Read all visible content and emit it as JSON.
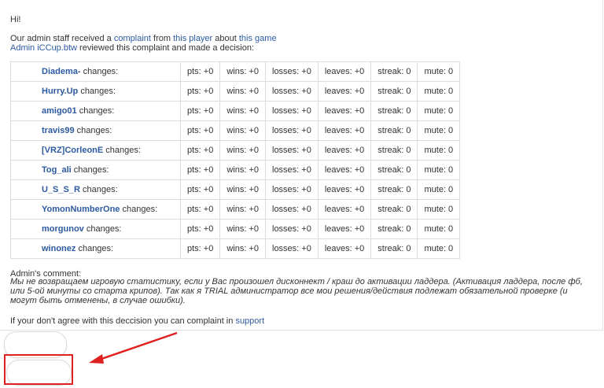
{
  "greeting": "Hi!",
  "intro": {
    "line1_pre": "Our admin staff received a",
    "complaint_link": "complaint",
    "line1_mid": "from",
    "player_link": "this player",
    "line1_mid2": "about",
    "game_link": "this game",
    "admin_link": "Admin iCCup.btw",
    "line2_post": "reviewed this complaint and made a decision:"
  },
  "changes_suffix": "changes:",
  "rows": [
    {
      "player": "Diadema-",
      "pts": "pts: +0",
      "wins": "wins: +0",
      "losses": "losses: +0",
      "leaves": "leaves: +0",
      "streak": "streak: 0",
      "mute": "mute: 0"
    },
    {
      "player": "Hurry.Up",
      "pts": "pts: +0",
      "wins": "wins: +0",
      "losses": "losses: +0",
      "leaves": "leaves: +0",
      "streak": "streak: 0",
      "mute": "mute: 0"
    },
    {
      "player": "amigo01",
      "pts": "pts: +0",
      "wins": "wins: +0",
      "losses": "losses: +0",
      "leaves": "leaves: +0",
      "streak": "streak: 0",
      "mute": "mute: 0"
    },
    {
      "player": "travis99",
      "pts": "pts: +0",
      "wins": "wins: +0",
      "losses": "losses: +0",
      "leaves": "leaves: +0",
      "streak": "streak: 0",
      "mute": "mute: 0"
    },
    {
      "player": "[VRZ]CorleonE",
      "pts": "pts: +0",
      "wins": "wins: +0",
      "losses": "losses: +0",
      "leaves": "leaves: +0",
      "streak": "streak: 0",
      "mute": "mute: 0"
    },
    {
      "player": "Tog_ali",
      "pts": "pts: +0",
      "wins": "wins: +0",
      "losses": "losses: +0",
      "leaves": "leaves: +0",
      "streak": "streak: 0",
      "mute": "mute: 0"
    },
    {
      "player": "U_S_S_R",
      "pts": "pts: +0",
      "wins": "wins: +0",
      "losses": "losses: +0",
      "leaves": "leaves: +0",
      "streak": "streak: 0",
      "mute": "mute: 0"
    },
    {
      "player": "YomonNumberOne",
      "pts": "pts: +0",
      "wins": "wins: +0",
      "losses": "losses: +0",
      "leaves": "leaves: +0",
      "streak": "streak: 0",
      "mute": "mute: 0"
    },
    {
      "player": "morgunov",
      "pts": "pts: +0",
      "wins": "wins: +0",
      "losses": "losses: +0",
      "leaves": "leaves: +0",
      "streak": "streak: 0",
      "mute": "mute: 0"
    },
    {
      "player": "winonez",
      "pts": "pts: +0",
      "wins": "wins: +0",
      "losses": "losses: +0",
      "leaves": "leaves: +0",
      "streak": "streak: 0",
      "mute": "mute: 0"
    }
  ],
  "admin_comment_label": "Admin's comment:",
  "admin_comment": "Мы не возвращаем игровую статистику, если у Вас произошел дисконнект / краш до активации ладдера. (Активация ладдера, после фб, или 5-ой минуты со старта крипов). Так как я TRIAL администратор все мои решения/действия подлежат обязательной проверке (и могут быть отменены, в случае ошибки).",
  "footer": {
    "text": "If your don't agree with this deccision you can complaint in",
    "support_link": "support"
  },
  "colors": {
    "link": "#2c5aa0",
    "annotation": "#e02020",
    "border": "#dcdcdc"
  }
}
